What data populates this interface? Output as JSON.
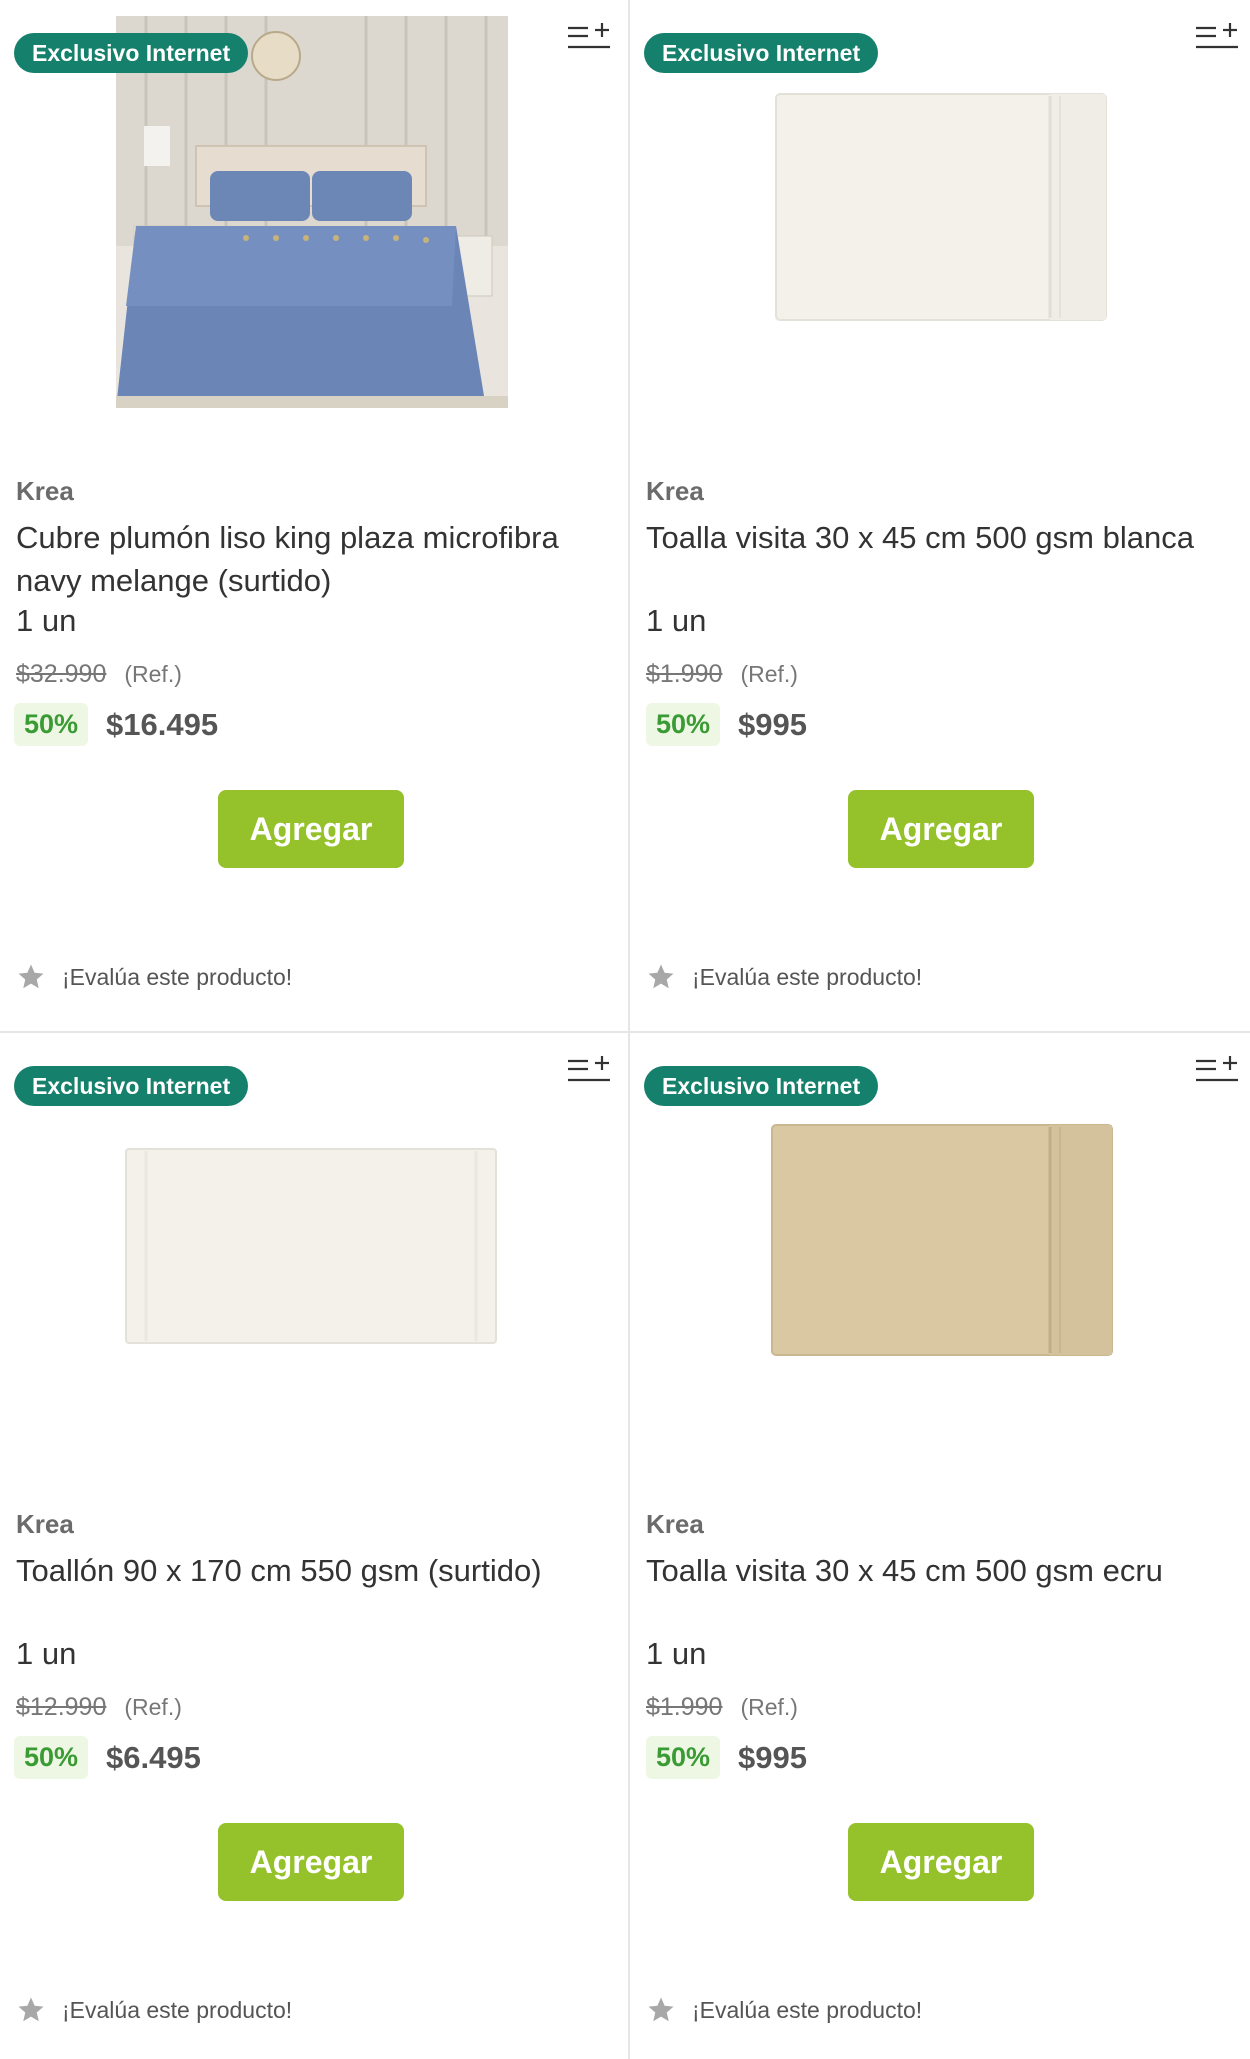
{
  "colors": {
    "badge_bg": "#15806b",
    "button_bg": "#95c12a",
    "discount_text": "#3a9b34",
    "discount_bg": "#eef7e4"
  },
  "products": [
    {
      "badge": "Exclusivo Internet",
      "image": "bedspread-icon",
      "brand": "Krea",
      "name": "Cubre plumón liso king plaza microfibra navy melange (surtido)",
      "unit": "1 un",
      "old_price": "$32.990",
      "ref": "(Ref.)",
      "discount": "50%",
      "price": "$16.495",
      "button": "Agregar",
      "rating": "¡Evalúa este producto!"
    },
    {
      "badge": "Exclusivo Internet",
      "image": "towel-white-icon",
      "brand": "Krea",
      "name": "Toalla visita 30 x 45 cm 500 gsm blanca",
      "unit": "1 un",
      "old_price": "$1.990",
      "ref": "(Ref.)",
      "discount": "50%",
      "price": "$995",
      "button": "Agregar",
      "rating": "¡Evalúa este producto!"
    },
    {
      "badge": "Exclusivo Internet",
      "image": "bath-towel-icon",
      "brand": "Krea",
      "name": "Toallón 90 x 170 cm 550 gsm (surtido)",
      "unit": "1 un",
      "old_price": "$12.990",
      "ref": "(Ref.)",
      "discount": "50%",
      "price": "$6.495",
      "button": "Agregar",
      "rating": "¡Evalúa este producto!"
    },
    {
      "badge": "Exclusivo Internet",
      "image": "towel-ecru-icon",
      "brand": "Krea",
      "name": "Toalla visita 30 x 45 cm 500 gsm ecru",
      "unit": "1 un",
      "old_price": "$1.990",
      "ref": "(Ref.)",
      "discount": "50%",
      "price": "$995",
      "button": "Agregar",
      "rating": "¡Evalúa este producto!"
    }
  ]
}
